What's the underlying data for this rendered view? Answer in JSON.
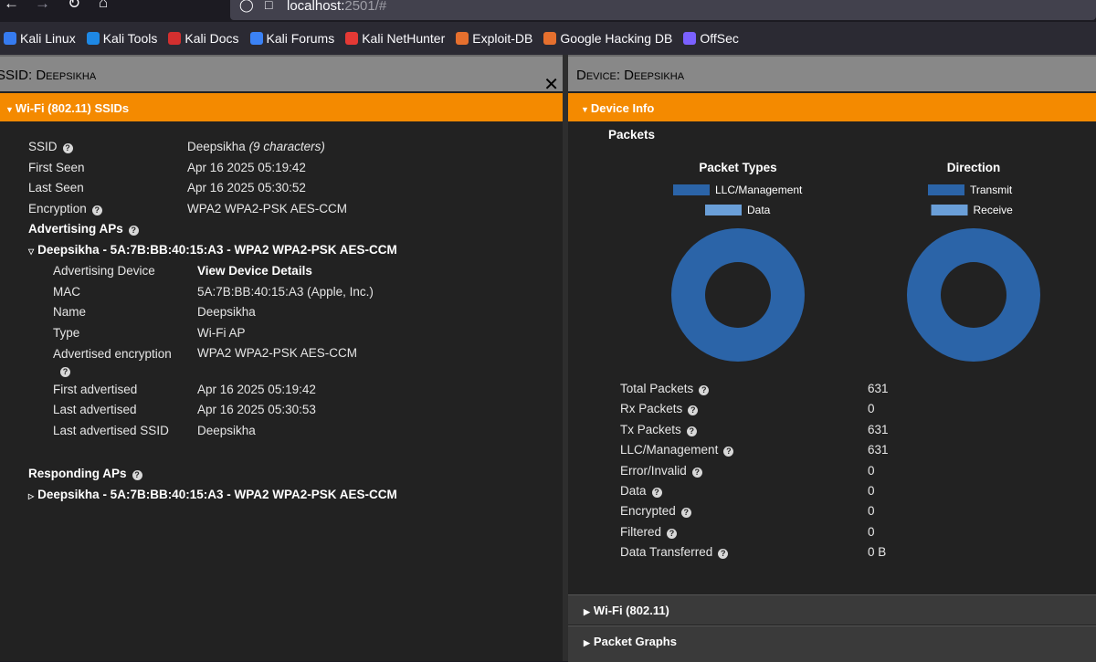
{
  "browser": {
    "url_host": "localhost:",
    "url_rest": "2501/#"
  },
  "bookmarks": [
    {
      "label": "Kali Linux",
      "icon": "kali-icon",
      "color": "#367bf0"
    },
    {
      "label": "Kali Tools",
      "icon": "kali-tools-icon",
      "color": "#1e88e5"
    },
    {
      "label": "Kali Docs",
      "icon": "kali-docs-icon",
      "color": "#d32f2f"
    },
    {
      "label": "Kali Forums",
      "icon": "kali-forums-icon",
      "color": "#3b82f6"
    },
    {
      "label": "Kali NetHunter",
      "icon": "nethunter-icon",
      "color": "#e53935"
    },
    {
      "label": "Exploit-DB",
      "icon": "exploit-db-icon",
      "color": "#e6702e"
    },
    {
      "label": "Google Hacking DB",
      "icon": "ghdb-icon",
      "color": "#e6702e"
    },
    {
      "label": "OffSec",
      "icon": "offsec-icon",
      "color": "#7b61ff"
    }
  ],
  "ssid_panel": {
    "title": "SSID: Deepsikha",
    "section": "Wi-Fi (802.11) SSIDs",
    "fields": {
      "ssid_label": "SSID",
      "ssid_value": "Deepsikha",
      "ssid_note": "(9 characters)",
      "first_seen_label": "First Seen",
      "first_seen_value": "Apr 16 2025 05:19:42",
      "last_seen_label": "Last Seen",
      "last_seen_value": "Apr 16 2025 05:30:52",
      "encryption_label": "Encryption",
      "encryption_value": "WPA2 WPA2-PSK AES-CCM"
    },
    "advertising_aps_label": "Advertising APs",
    "advertising_ap_header": "Deepsikha - 5A:7B:BB:40:15:A3 - WPA2 WPA2-PSK AES-CCM",
    "ap_details": {
      "device_label": "Advertising Device",
      "device_link": "View Device Details",
      "mac_label": "MAC",
      "mac_value": "5A:7B:BB:40:15:A3 (Apple, Inc.)",
      "name_label": "Name",
      "name_value": "Deepsikha",
      "type_label": "Type",
      "type_value": "Wi-Fi AP",
      "enc_label": "Advertised encryption",
      "enc_value": "WPA2 WPA2-PSK AES-CCM",
      "first_label": "First advertised",
      "first_value": "Apr 16 2025 05:19:42",
      "last_label": "Last advertised",
      "last_value": "Apr 16 2025 05:30:53",
      "last_ssid_label": "Last advertised SSID",
      "last_ssid_value": "Deepsikha"
    },
    "responding_aps_label": "Responding APs",
    "responding_ap_header": "Deepsikha - 5A:7B:BB:40:15:A3 - WPA2 WPA2-PSK AES-CCM"
  },
  "device_panel": {
    "title": "Device: Deepsikha",
    "section": "Device Info",
    "packets_label": "Packets",
    "stats": [
      {
        "label": "Total Packets",
        "value": "631"
      },
      {
        "label": "Rx Packets",
        "value": "0"
      },
      {
        "label": "Tx Packets",
        "value": "631"
      },
      {
        "label": "LLC/Management",
        "value": "631"
      },
      {
        "label": "Error/Invalid",
        "value": "0"
      },
      {
        "label": "Data",
        "value": "0"
      },
      {
        "label": "Encrypted",
        "value": "0"
      },
      {
        "label": "Filtered",
        "value": "0"
      },
      {
        "label": "Data Transferred",
        "value": "0 B"
      }
    ],
    "collapsed_sections": [
      "Wi-Fi (802.11)",
      "Packet Graphs"
    ]
  },
  "chart_data": [
    {
      "type": "pie",
      "title": "Packet Types",
      "categories": [
        "LLC/Management",
        "Data"
      ],
      "values": [
        631,
        0
      ],
      "colors": [
        "#2b64a8",
        "#6a9fd8"
      ],
      "legend": "top"
    },
    {
      "type": "pie",
      "title": "Direction",
      "categories": [
        "Transmit",
        "Receive"
      ],
      "values": [
        631,
        0
      ],
      "colors": [
        "#2b64a8",
        "#6a9fd8"
      ],
      "legend": "top"
    }
  ]
}
